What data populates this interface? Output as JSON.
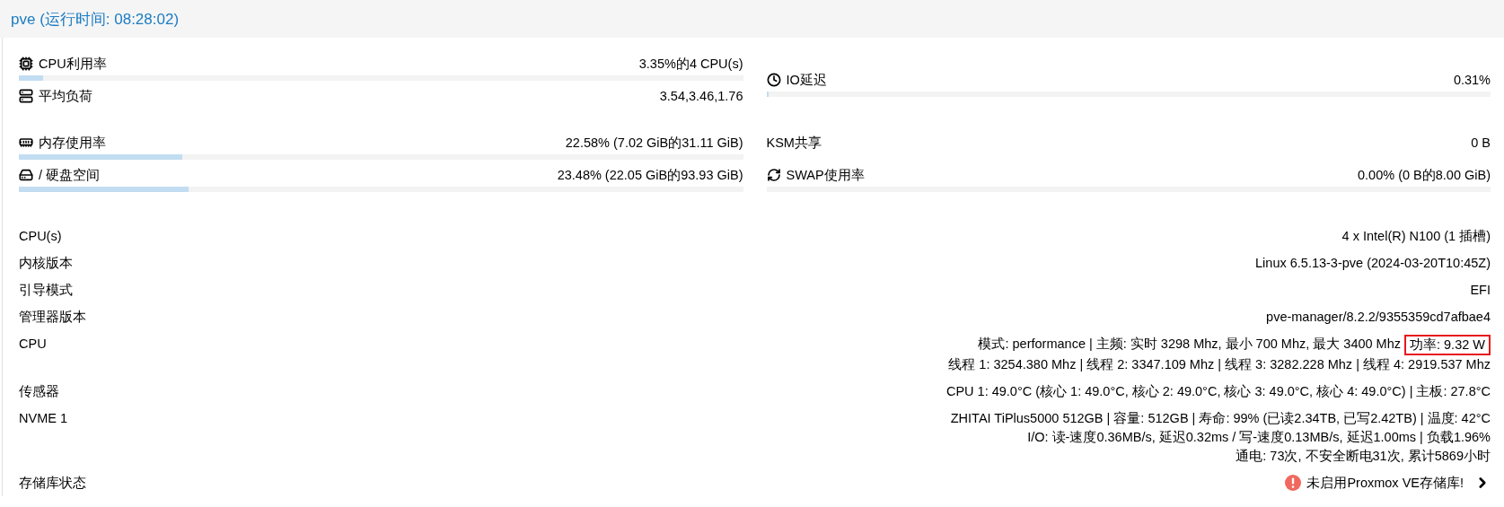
{
  "header": {
    "title": "pve (运行时间: 08:28:02)"
  },
  "summary": {
    "columns": [
      {
        "groups": [
          [
            {
              "label": "CPU利用率",
              "value": "3.35%的4 CPU(s)",
              "level": 0.0335
            },
            {
              "label": "平均负荷",
              "value": "3.54,3.46,1.76"
            }
          ],
          [
            {
              "label": "内存使用率",
              "value": "22.58% (7.02 GiB的31.11 GiB)",
              "level": 0.2258
            },
            {
              "label": "/ 硬盘空间",
              "value": "23.48% (22.05 GiB的93.93 GiB)",
              "level": 0.2348
            }
          ]
        ]
      },
      {
        "groups": [
          [
            {
              "label": "IO延迟",
              "value": "0.31%",
              "level": 0.0031
            }
          ],
          [
            {
              "label": "KSM共享",
              "value": "0 B"
            },
            {
              "label": "SWAP使用率",
              "value": "0.00% (0 B的8.00 GiB)",
              "level": 0
            }
          ]
        ]
      }
    ]
  },
  "info": [
    {
      "kind": "text",
      "label": "CPU(s)",
      "lines": [
        {
          "text": "4 x Intel(R) N100 (1 插槽)"
        }
      ]
    },
    {
      "kind": "text",
      "label": "内核版本",
      "lines": [
        {
          "text": "Linux 6.5.13-3-pve (2024-03-20T10:45Z)"
        }
      ]
    },
    {
      "kind": "text",
      "label": "引导模式",
      "lines": [
        {
          "text": "EFI"
        }
      ]
    },
    {
      "kind": "text",
      "label": "管理器版本",
      "lines": [
        {
          "text": "pve-manager/8.2.2/9355359cd7afbae4"
        }
      ]
    },
    {
      "kind": "text",
      "label": "CPU",
      "lines": [
        {
          "text": "模式: performance | 主频: 实时 3298 Mhz, 最小 700 Mhz, 最大 3400 Mhz",
          "marked_text": "功率: 9.32 W"
        },
        {
          "text": "线程 1: 3254.380 Mhz | 线程 2: 3347.109 Mhz | 线程 3: 3282.228 Mhz | 线程 4: 2919.537 Mhz"
        }
      ]
    },
    {
      "kind": "text",
      "label": "传感器",
      "lines": [
        {
          "text": "CPU 1: 49.0°C (核心 1: 49.0°C, 核心 2: 49.0°C, 核心 3: 49.0°C, 核心 4: 49.0°C) | 主板: 27.8°C"
        }
      ]
    },
    {
      "kind": "text",
      "label": "NVME 1",
      "lines": [
        {
          "text": "ZHITAI TiPlus5000 512GB | 容量: 512GB | 寿命: 99% (已读2.34TB, 已写2.42TB) | 温度: 42°C"
        },
        {
          "text": "I/O: 读-速度0.36MB/s, 延迟0.32ms / 写-速度0.13MB/s, 延迟1.00ms | 负载1.96%"
        },
        {
          "text": "通电: 73次, 不安全断电31次, 累计5869小时"
        }
      ]
    },
    {
      "kind": "status",
      "label": "存储库状态",
      "lines": [
        {
          "text": "未启用Proxmox VE存储库!"
        }
      ]
    }
  ]
}
